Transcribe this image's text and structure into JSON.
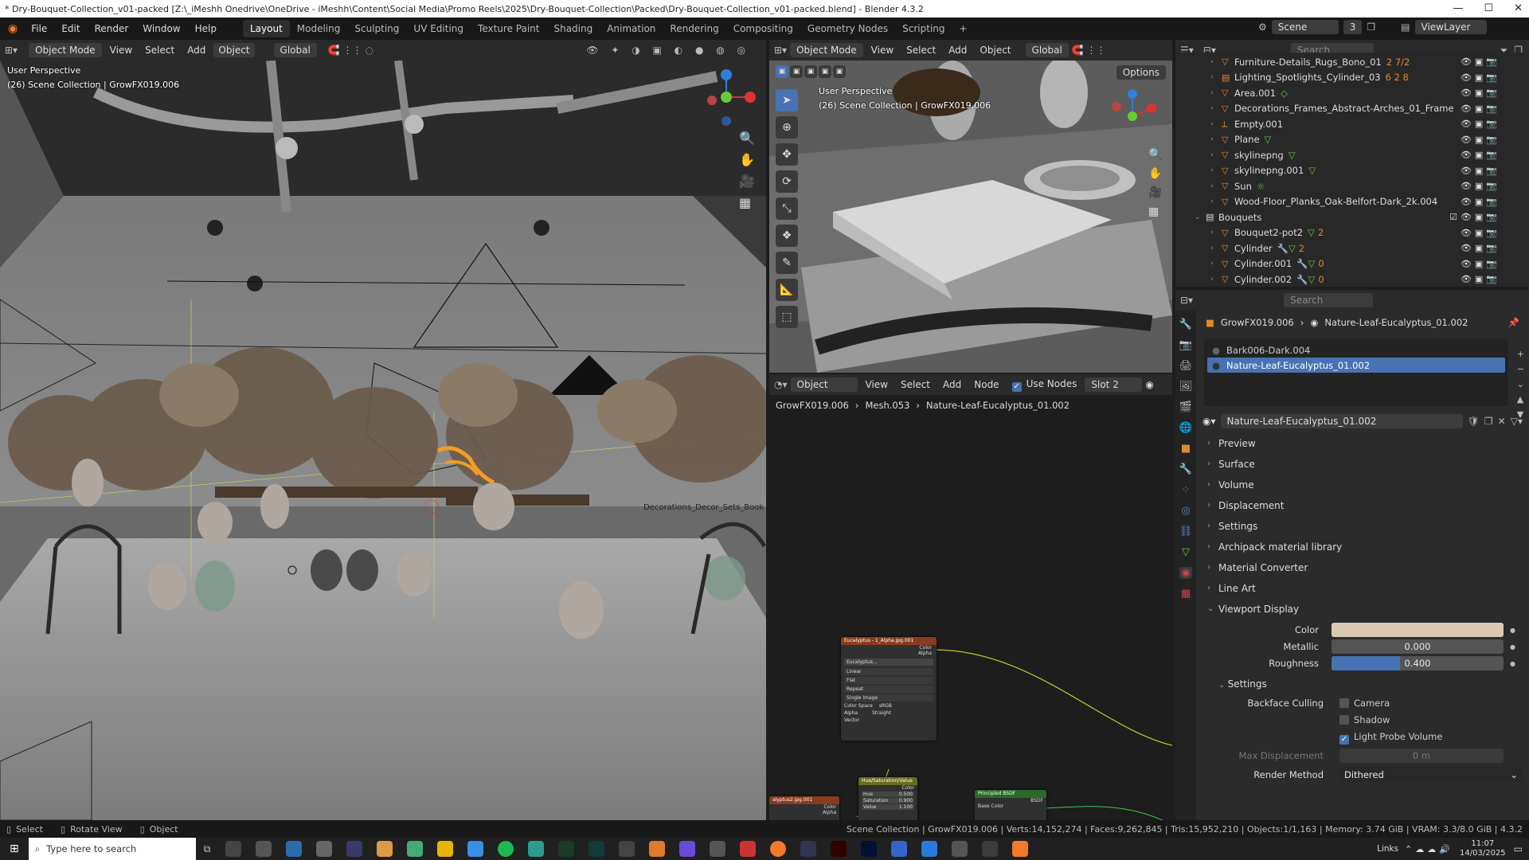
{
  "window": {
    "title": "* Dry-Bouquet-Collection_v01-packed [Z:\\_iMeshh Onedrive\\OneDrive - iMeshh\\Content\\Social Media\\Promo Reels\\2025\\Dry-Bouquet-Collection\\Packed\\Dry-Bouquet-Collection_v01-packed.blend] - Blender 4.3.2",
    "minimize": "—",
    "maximize": "☐",
    "close": "✕"
  },
  "menu": {
    "items": [
      "File",
      "Edit",
      "Render",
      "Window",
      "Help"
    ],
    "workspaces": [
      "Layout",
      "Modeling",
      "Sculpting",
      "UV Editing",
      "Texture Paint",
      "Shading",
      "Animation",
      "Rendering",
      "Compositing",
      "Geometry Nodes",
      "Scripting"
    ],
    "add_tab": "+",
    "scene_label": "Scene",
    "scene_count": "3",
    "view_layer": "ViewLayer"
  },
  "viewport_main": {
    "mode": "Object Mode",
    "menus": [
      "View",
      "Select",
      "Add",
      "Object"
    ],
    "transform": "Global",
    "perspective": "User Perspective",
    "collection": "(26) Scene Collection | GrowFX019.006",
    "scene_text": "Decorations_Decor_Sets_Book"
  },
  "viewport_top": {
    "mode": "Object Mode",
    "menus": [
      "View",
      "Select",
      "Add",
      "Object"
    ],
    "transform": "Global",
    "options": "Options",
    "perspective": "User Perspective",
    "collection": "(26) Scene Collection | GrowFX019.006"
  },
  "outliner": {
    "search_placeholder": "Search",
    "items": [
      {
        "name": "Furniture-Details_Rugs_Bono_01",
        "badge": "2 7/2"
      },
      {
        "name": "Lighting_Spotlights_Cylinder_03",
        "badge": "6 2 8"
      },
      {
        "name": "Area.001",
        "badge": ""
      },
      {
        "name": "Decorations_Frames_Abstract-Arches_01_Frame",
        "badge": ""
      },
      {
        "name": "Empty.001",
        "badge": ""
      },
      {
        "name": "Plane",
        "badge": ""
      },
      {
        "name": "skylinepng",
        "badge": ""
      },
      {
        "name": "skylinepng.001",
        "badge": ""
      },
      {
        "name": "Sun",
        "badge": ""
      },
      {
        "name": "Wood-Floor_Planks_Oak-Belfort-Dark_2k.004",
        "badge": ""
      },
      {
        "name": "Bouquets",
        "badge": ""
      },
      {
        "name": "Bouquet2-pot2",
        "badge": "2"
      },
      {
        "name": "Cylinder",
        "badge": "2"
      },
      {
        "name": "Cylinder.001",
        "badge": "0"
      },
      {
        "name": "Cylinder.002",
        "badge": "0"
      }
    ]
  },
  "node_editor": {
    "type": "Object",
    "menus": [
      "View",
      "Select",
      "Add",
      "Node"
    ],
    "use_nodes": "Use Nodes",
    "slot": "Slot 2",
    "breadcrumb": [
      "GrowFX019.006",
      "Mesh.053",
      "Nature-Leaf-Eucalyptus_01.002"
    ],
    "nodes": {
      "image": {
        "title": "Eucalyptus - 1_Alpha.jpg.001",
        "out_color": "Color",
        "out_alpha": "Alpha",
        "file": "Eucalyptus...",
        "interp": "Linear",
        "proj": "Flat",
        "ext": "Repeat",
        "source": "Single Image",
        "cs_label": "Color Space",
        "cs_val": "sRGB",
        "alpha_label": "Alpha",
        "alpha_val": "Straight",
        "vector": "Vector"
      },
      "hsv": {
        "title": "Hue/Saturation/Value",
        "out": "Color",
        "hue": "Hue",
        "hue_v": "0.500",
        "sat": "Saturation",
        "sat_v": "0.900",
        "val": "Value",
        "val_v": "1.100"
      },
      "bsdf": {
        "title": "Principled BSDF",
        "out": "BSDF",
        "base": "Base Color"
      },
      "left": {
        "title": "alyptus2.jpg.001",
        "c": "Color",
        "a": "Alpha"
      }
    }
  },
  "properties": {
    "search_placeholder": "Search",
    "breadcrumb": [
      "GrowFX019.006",
      "Nature-Leaf-Eucalyptus_01.002"
    ],
    "slots": [
      "Bark006-Dark.004",
      "Nature-Leaf-Eucalyptus_01.002"
    ],
    "material_name": "Nature-Leaf-Eucalyptus_01.002",
    "sections": [
      "Preview",
      "Surface",
      "Volume",
      "Displacement",
      "Settings",
      "Archipack material library",
      "Material Converter",
      "Line Art"
    ],
    "viewport_display": "Viewport Display",
    "color_label": "Color",
    "color_value": "#d9c9b0",
    "metallic_label": "Metallic",
    "metallic_value": "0.000",
    "roughness_label": "Roughness",
    "roughness_value": "0.400",
    "roughness_fraction": 0.4,
    "settings_sub": "Settings",
    "backface_label": "Backface Culling",
    "camera_label": "Camera",
    "shadow_label": "Shadow",
    "lightprobe_label": "Light Probe Volume",
    "maxdisp_label": "Max Displacement",
    "maxdisp_value": "0 m",
    "render_method_label": "Render Method",
    "render_method_value": "Dithered"
  },
  "status": {
    "select": "Select",
    "rotate": "Rotate View",
    "object": "Object",
    "stats": "Scene Collection | GrowFX019.006 | Verts:14,152,274 | Faces:9,262,845 | Tris:15,952,210 | Objects:1/1,163 | Memory: 3.74 GiB | VRAM: 3.3/8.0 GiB | 4.3.2"
  },
  "taskbar": {
    "search": "Type here to search",
    "links": "Links",
    "time": "11:07",
    "date": "14/03/2025"
  }
}
